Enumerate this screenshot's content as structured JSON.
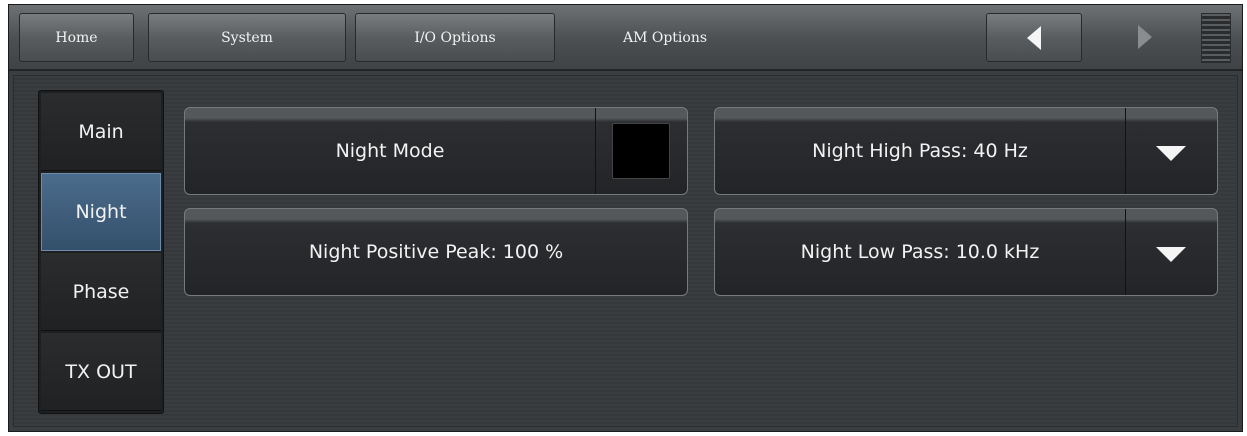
{
  "topnav": {
    "tabs": [
      {
        "label": "Home"
      },
      {
        "label": "System"
      },
      {
        "label": "I/O Options"
      },
      {
        "label": "AM Options"
      }
    ],
    "icons": [
      "arrow-left-icon",
      "arrow-right-icon",
      "menu-icon"
    ]
  },
  "sidebar": {
    "items": [
      {
        "label": "Main"
      },
      {
        "label": "Night",
        "active": true
      },
      {
        "label": "Phase"
      },
      {
        "label": "TX OUT"
      }
    ]
  },
  "controls": {
    "night_mode": {
      "label": "Night Mode",
      "checked": false
    },
    "night_high_pass": {
      "label": "Night High Pass: 40 Hz"
    },
    "night_positive_peak": {
      "label": "Night Positive Peak: 100 %"
    },
    "night_low_pass": {
      "label": "Night Low Pass: 10.0 kHz"
    }
  },
  "colors": {
    "active_tab": "#3f5f7f",
    "checkbox_fill": "#000000"
  }
}
